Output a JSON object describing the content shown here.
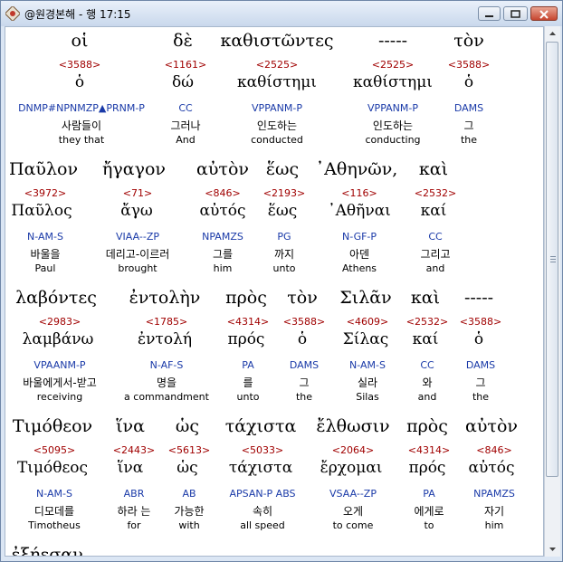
{
  "window": {
    "title": "@원경본해 - 행 17:15"
  },
  "rows": [
    {
      "words": [
        {
          "greek": "οἱ",
          "strong": "<3588>",
          "lemma": "ὁ",
          "parse": "DNMP#NPNMZP▲PRNM-P",
          "korean": "사람들이",
          "english": "they that"
        },
        {
          "greek": "δὲ",
          "strong": "<1161>",
          "lemma": "δώ",
          "parse": "CC",
          "korean": "그러나",
          "english": "And"
        },
        {
          "greek": "καθιστῶντες",
          "strong": "<2525>",
          "lemma": "καθίστημι",
          "parse": "VPPANM-P",
          "korean": "인도하는",
          "english": "conducted"
        },
        {
          "greek": "-----",
          "strong": "<2525>",
          "lemma": "καθίστημι",
          "parse": "VPPANM-P",
          "korean": "인도하는",
          "english": "conducting"
        },
        {
          "greek": "τὸν",
          "strong": "<3588>",
          "lemma": "ὁ",
          "parse": "DAMS",
          "korean": "그",
          "english": "the"
        }
      ]
    },
    {
      "words": [
        {
          "greek": "Παῦλον",
          "strong": "<3972>",
          "lemma": "Παῦλος",
          "parse": "N-AM-S",
          "korean": "바울을",
          "english": "Paul"
        },
        {
          "greek": "ἤγαγον",
          "strong": "<71>",
          "lemma": "ἄγω",
          "parse": "VIAA--ZP",
          "korean": "데리고-이르러",
          "english": "brought"
        },
        {
          "greek": "αὐτὸν",
          "strong": "<846>",
          "lemma": "αὐτός",
          "parse": "NPAMZS",
          "korean": "그를",
          "english": "him"
        },
        {
          "greek": "ἕως",
          "strong": "<2193>",
          "lemma": "ἕως",
          "parse": "PG",
          "korean": "까지",
          "english": "unto"
        },
        {
          "greek": "᾿Αθηνῶν,",
          "strong": "<116>",
          "lemma": "᾿Αθῆναι",
          "parse": "N-GF-P",
          "korean": "아덴",
          "english": "Athens"
        },
        {
          "greek": "καὶ",
          "strong": "<2532>",
          "lemma": "καί",
          "parse": "CC",
          "korean": "그리고",
          "english": "and"
        }
      ]
    },
    {
      "words": [
        {
          "greek": "λαβόντες",
          "strong": "<2983>",
          "lemma": "λαμβάνω",
          "parse": "VPAANM-P",
          "korean": "바울에게서-받고",
          "english": "receiving"
        },
        {
          "greek": "ἐντολὴν",
          "strong": "<1785>",
          "lemma": "ἐντολή",
          "parse": "N-AF-S",
          "korean": "명을",
          "english": "a commandment"
        },
        {
          "greek": "πρὸς",
          "strong": "<4314>",
          "lemma": "πρός",
          "parse": "PA",
          "korean": "를",
          "english": "unto"
        },
        {
          "greek": "τὸν",
          "strong": "<3588>",
          "lemma": "ὁ",
          "parse": "DAMS",
          "korean": "그",
          "english": "the"
        },
        {
          "greek": "Σιλᾶν",
          "strong": "<4609>",
          "lemma": "Σίλας",
          "parse": "N-AM-S",
          "korean": "실라",
          "english": "Silas"
        },
        {
          "greek": "καὶ",
          "strong": "<2532>",
          "lemma": "καί",
          "parse": "CC",
          "korean": "와",
          "english": "and"
        },
        {
          "greek": "-----",
          "strong": "<3588>",
          "lemma": "ὁ",
          "parse": "DAMS",
          "korean": "그",
          "english": "the"
        }
      ]
    },
    {
      "words": [
        {
          "greek": "Τιμόθεον",
          "strong": "<5095>",
          "lemma": "Τιμόθεος",
          "parse": "N-AM-S",
          "korean": "디모데를",
          "english": "Timotheus"
        },
        {
          "greek": "ἵνα",
          "strong": "<2443>",
          "lemma": "ἵνα",
          "parse": "ABR",
          "korean": "하라 는",
          "english": "for"
        },
        {
          "greek": "ὡς",
          "strong": "<5613>",
          "lemma": "ὡς",
          "parse": "AB",
          "korean": "가능한",
          "english": "with"
        },
        {
          "greek": "τάχιστα",
          "strong": "<5033>",
          "lemma": "τάχιστα",
          "parse": "APSAN-P ABS",
          "korean": "속히",
          "english": "all speed"
        },
        {
          "greek": "ἔλθωσιν",
          "strong": "<2064>",
          "lemma": "ἔρχομαι",
          "parse": "VSAA--ZP",
          "korean": "오게",
          "english": "to come"
        },
        {
          "greek": "πρὸς",
          "strong": "<4314>",
          "lemma": "πρός",
          "parse": "PA",
          "korean": "에게로",
          "english": "to"
        },
        {
          "greek": "αὐτὸν",
          "strong": "<846>",
          "lemma": "αὐτός",
          "parse": "NPAMZS",
          "korean": "자기",
          "english": "him"
        }
      ]
    },
    {
      "words": [
        {
          "greek": "ἐξῄεσαν"
        }
      ]
    }
  ]
}
